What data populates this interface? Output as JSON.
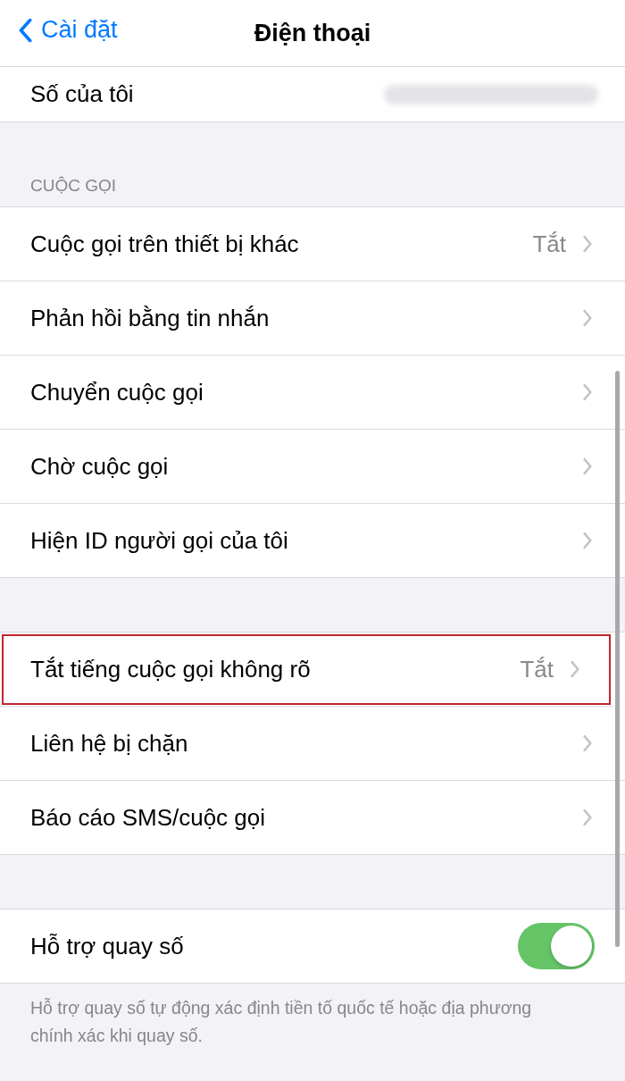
{
  "nav": {
    "back_label": "Cài đặt",
    "title": "Điện thoại"
  },
  "sections": [
    {
      "rows": [
        {
          "kind": "redacted",
          "label": "Số của tôi"
        }
      ]
    },
    {
      "header": "CUỘC GỌI",
      "rows": [
        {
          "kind": "link",
          "label": "Cuộc gọi trên thiết bị khác",
          "value": "Tắt",
          "highlighted": false
        },
        {
          "kind": "link",
          "label": "Phản hồi bằng tin nhắn",
          "highlighted": false
        },
        {
          "kind": "link",
          "label": "Chuyển cuộc gọi",
          "highlighted": false
        },
        {
          "kind": "link",
          "label": "Chờ cuộc gọi",
          "highlighted": false
        },
        {
          "kind": "link",
          "label": "Hiện ID người gọi của tôi",
          "highlighted": false
        }
      ]
    },
    {
      "rows": [
        {
          "kind": "link",
          "label": "Tắt tiếng cuộc gọi không rõ",
          "value": "Tắt",
          "highlighted": true
        },
        {
          "kind": "link",
          "label": "Liên hệ bị chặn",
          "highlighted": false
        },
        {
          "kind": "link",
          "label": "Báo cáo SMS/cuộc gọi",
          "highlighted": false
        }
      ]
    },
    {
      "rows": [
        {
          "kind": "toggle",
          "label": "Hỗ trợ quay số",
          "on": true
        }
      ],
      "footer": "Hỗ trợ quay số tự động xác định tiền tố quốc tế hoặc địa phương chính xác khi quay số."
    }
  ]
}
